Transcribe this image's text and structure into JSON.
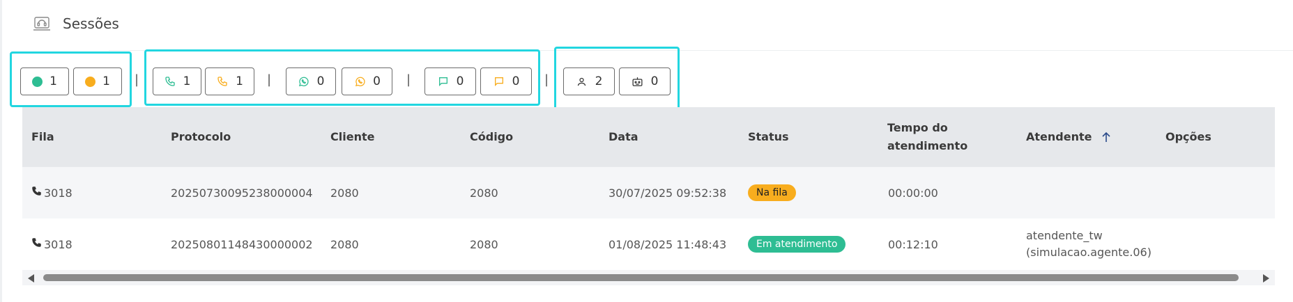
{
  "header": {
    "title": "Sessões",
    "icon": "headset-monitor-icon"
  },
  "colors": {
    "cyan_frame": "#22d6e0",
    "green": "#2ebd93",
    "orange": "#f8ad1e",
    "header_bg": "#e6e8eb"
  },
  "counters": {
    "status": {
      "active": "1",
      "waiting": "1"
    },
    "phone": {
      "active": "1",
      "waiting": "1"
    },
    "whatsapp": {
      "active": "0",
      "waiting": "0"
    },
    "chat": {
      "active": "0",
      "waiting": "0"
    },
    "agents": {
      "users": "2",
      "bots": "0"
    },
    "separator": "|"
  },
  "table": {
    "columns": [
      "Fila",
      "Protocolo",
      "Cliente",
      "Código",
      "Data",
      "Status",
      "Tempo do atendimento",
      "Atendente",
      "Opções"
    ],
    "rows": [
      {
        "fila": "3018",
        "protocolo": "20250730095238000004",
        "cliente": "2080",
        "codigo": "2080",
        "data": "30/07/2025 09:52:38",
        "status": "Na fila",
        "tempo": "00:00:00",
        "atendente": ""
      },
      {
        "fila": "3018",
        "protocolo": "20250801148430000002",
        "cliente": "2080",
        "codigo": "2080",
        "data": "01/08/2025 11:48:43",
        "status": "Em atendimento",
        "tempo": "00:12:10",
        "atendente": "atendente_tw (simulacao.agente.06)"
      }
    ]
  }
}
